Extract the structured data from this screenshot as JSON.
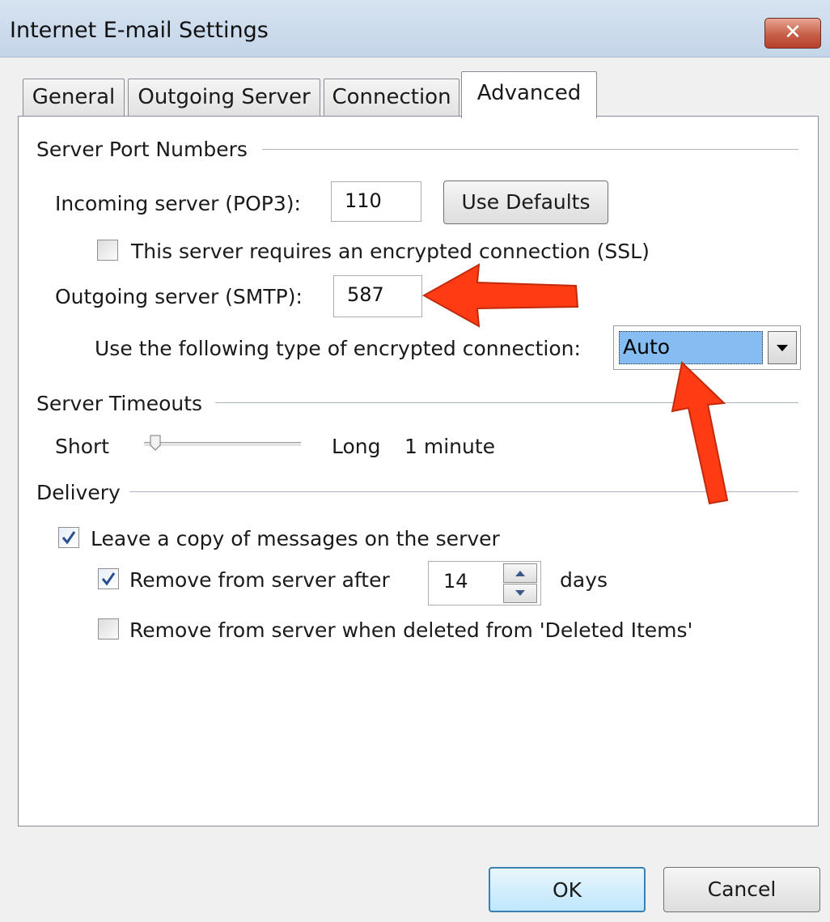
{
  "window": {
    "title": "Internet E-mail Settings",
    "close_label": "✕"
  },
  "tabs": [
    {
      "label": "General",
      "active": false
    },
    {
      "label": "Outgoing Server",
      "active": false
    },
    {
      "label": "Connection",
      "active": false
    },
    {
      "label": "Advanced",
      "active": true
    }
  ],
  "ports": {
    "group_label": "Server Port Numbers",
    "incoming_label": "Incoming server (POP3):",
    "incoming_value": "110",
    "use_defaults_label": "Use Defaults",
    "ssl_label": "This server requires an encrypted connection (SSL)",
    "ssl_checked": false,
    "outgoing_label": "Outgoing server (SMTP):",
    "outgoing_value": "587",
    "encryption_label": "Use the following type of encrypted connection:",
    "encryption_value": "Auto"
  },
  "timeouts": {
    "group_label": "Server Timeouts",
    "short_label": "Short",
    "long_label": "Long",
    "value_label": "1 minute",
    "slider_fraction": 0.07
  },
  "delivery": {
    "group_label": "Delivery",
    "leave_copy_label": "Leave a copy of messages on the server",
    "leave_copy_checked": true,
    "remove_after_label": "Remove from server after",
    "remove_after_checked": true,
    "remove_after_days": "14",
    "days_label": "days",
    "remove_deleted_label": "Remove from server when deleted from 'Deleted Items'",
    "remove_deleted_checked": false
  },
  "footer": {
    "ok_label": "OK",
    "cancel_label": "Cancel"
  },
  "colors": {
    "annotation_arrow": "#ff3b14",
    "selection": "#85bdf2"
  }
}
